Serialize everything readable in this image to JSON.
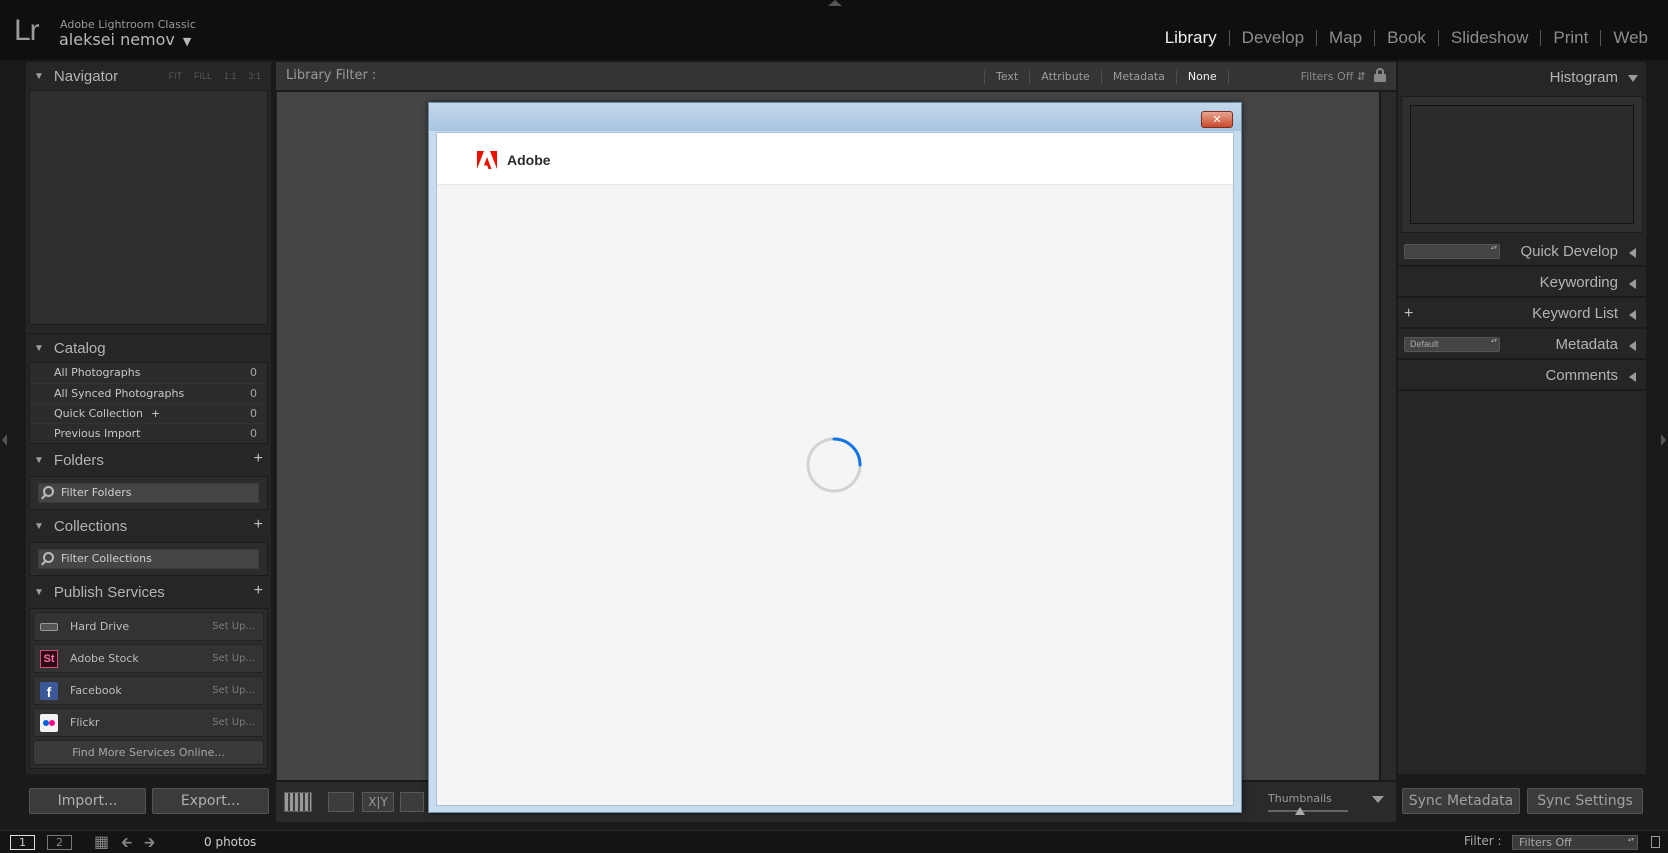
{
  "app": {
    "logo": "Lr",
    "name": "Adobe Lightroom Classic",
    "user": "aleksei nemov"
  },
  "modules": [
    "Library",
    "Develop",
    "Map",
    "Book",
    "Slideshow",
    "Print",
    "Web"
  ],
  "active_module": "Library",
  "left_panel": {
    "navigator": {
      "title": "Navigator",
      "zoom": [
        "FIT",
        "FILL",
        "1:1",
        "3:1"
      ]
    },
    "catalog": {
      "title": "Catalog",
      "items": [
        {
          "label": "All Photographs",
          "count": "0"
        },
        {
          "label": "All Synced Photographs",
          "count": "0"
        },
        {
          "label": "Quick Collection",
          "suffix": "+",
          "count": "0"
        },
        {
          "label": "Previous Import",
          "count": "0"
        }
      ]
    },
    "folders": {
      "title": "Folders",
      "filter_placeholder": "Filter Folders"
    },
    "collections": {
      "title": "Collections",
      "filter_placeholder": "Filter Collections"
    },
    "publish_services": {
      "title": "Publish Services",
      "items": [
        {
          "label": "Hard Drive",
          "action": "Set Up...",
          "icon": "hard-drive-icon"
        },
        {
          "label": "Adobe Stock",
          "action": "Set Up...",
          "icon": "adobe-stock-icon",
          "icon_text": "St"
        },
        {
          "label": "Facebook",
          "action": "Set Up...",
          "icon": "facebook-icon",
          "icon_text": "f"
        },
        {
          "label": "Flickr",
          "action": "Set Up...",
          "icon": "flickr-icon"
        }
      ],
      "find_more": "Find More Services Online..."
    },
    "import_label": "Import...",
    "export_label": "Export..."
  },
  "filter_bar": {
    "label": "Library Filter :",
    "options": [
      "Text",
      "Attribute",
      "Metadata",
      "None"
    ],
    "active": "None",
    "preset": "Filters Off"
  },
  "toolbar": {
    "thumbnails_label": "Thumbnails",
    "thumbnail_size": 0.4
  },
  "right_panel": {
    "histogram": "Histogram",
    "quick_develop": "Quick Develop",
    "keywording": "Keywording",
    "keyword_list": "Keyword List",
    "metadata": "Metadata",
    "metadata_preset": "Default",
    "comments": "Comments",
    "sync_metadata": "Sync Metadata",
    "sync_settings": "Sync Settings"
  },
  "filmstrip": {
    "screen_1": "1",
    "screen_2": "2",
    "photo_count": "0 photos",
    "filter_label": "Filter :",
    "filter_value": "Filters Off"
  },
  "modal": {
    "close_label": "✕",
    "brand": "Adobe",
    "brand_color": "#eb1000",
    "spinner_color": "#1473e6"
  }
}
